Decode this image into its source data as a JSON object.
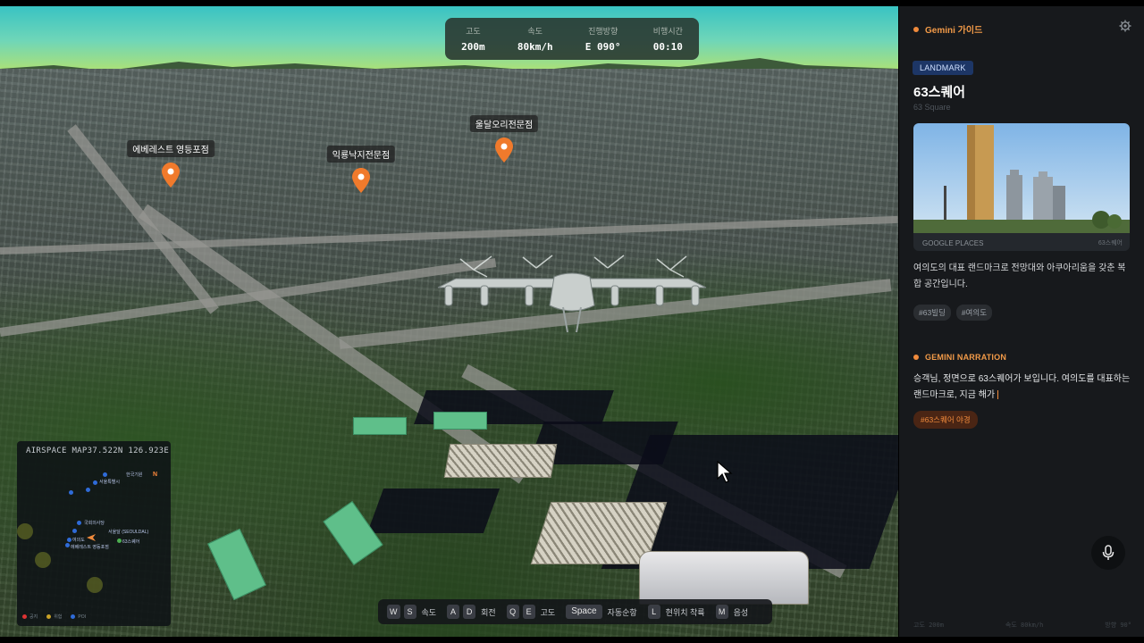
{
  "hud": [
    {
      "label": "고도",
      "value": "200m"
    },
    {
      "label": "속도",
      "value": "80km/h"
    },
    {
      "label": "진행방향",
      "value": "E 090°"
    },
    {
      "label": "비행시간",
      "value": "00:10"
    }
  ],
  "pois": [
    {
      "label": "에베레스트 영등포점"
    },
    {
      "label": "익룡낙지전문점"
    },
    {
      "label": "울달오리전문점"
    }
  ],
  "minimap": {
    "title": "AIRSPACE MAP37.522N 126.923E",
    "compass": "N",
    "places": [
      "한국기원",
      "서울특별시",
      "국회의사당",
      "여의도",
      "서울달 (SEOULDAL)",
      "63스퀘어",
      "에베레스트 영등포점"
    ],
    "legend": [
      "공지",
      "위험",
      "POI"
    ]
  },
  "keys": [
    {
      "keys": [
        "W",
        "S"
      ],
      "desc": "속도"
    },
    {
      "keys": [
        "A",
        "D"
      ],
      "desc": "회전"
    },
    {
      "keys": [
        "Q",
        "E"
      ],
      "desc": "고도"
    },
    {
      "keys": [
        "Space"
      ],
      "desc": "자동순항"
    },
    {
      "keys": [
        "L"
      ],
      "desc": "현위치 착륙"
    },
    {
      "keys": [
        "M"
      ],
      "desc": "음성"
    }
  ],
  "panel": {
    "title": "Gemini 가이드",
    "badge": "LANDMARK",
    "landmark_name": "63스퀘어",
    "landmark_sub": "63 Square",
    "photo_source": "GOOGLE PLACES",
    "photo_name": "63스퀘어",
    "description": "여의도의 대표 랜드마크로 전망대와 아쿠아리움을 갖춘 복합 공간입니다.",
    "tags": [
      "#63빌딩",
      "#여의도"
    ],
    "narration_title": "GEMINI NARRATION",
    "narration_text": "승객님, 정면으로 63스퀘어가 보입니다. 여의도를 대표하는 랜드마크로, 지금 해가",
    "narration_chip": "#63스퀘어 야경",
    "footer": [
      "고도 200m",
      "속도 80km/h",
      "방향 90°"
    ]
  },
  "colors": {
    "accent": "#f08a3c",
    "badge_bg": "#1d3666",
    "panel_bg": "#17191c"
  },
  "icons": [
    "gear-icon",
    "microphone-icon",
    "map-pin-icon",
    "cursor-icon"
  ]
}
